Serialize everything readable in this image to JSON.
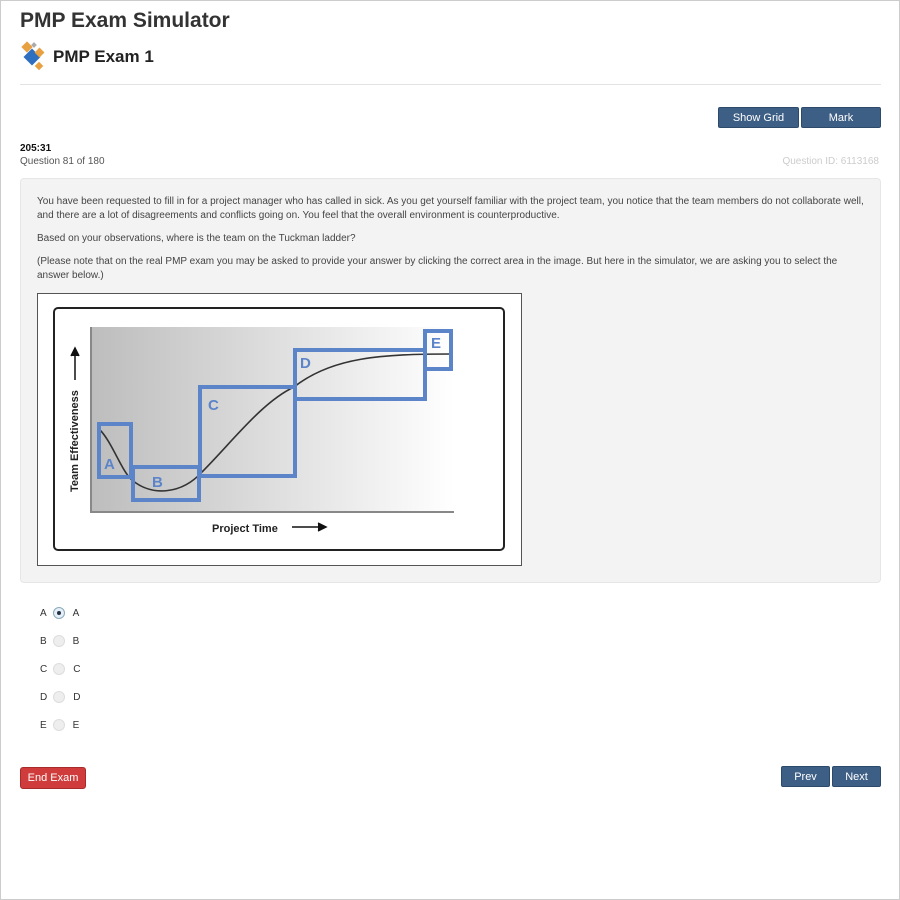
{
  "app_title": "PMP Exam Simulator",
  "exam_title": "PMP Exam 1",
  "toolbar": {
    "show_grid": "Show Grid",
    "mark": "Mark"
  },
  "timer": "205:31",
  "question_number": "Question 81 of 180",
  "question_id": "Question ID: 6113168",
  "question": {
    "p1": "You have been requested to fill in for a project manager who has called in sick. As you get yourself familiar with the project team, you notice that the team members do not collaborate well, and there are a lot of disagreements and conflicts going on. You feel that the overall environment is counterproductive.",
    "p2": "Based on your observations, where is the team on the Tuckman ladder?",
    "p3": "(Please note that on the real PMP exam you may be asked to provide your answer by clicking the correct area in the image. But here in the simulator, we are asking you to select the answer below.)"
  },
  "figure": {
    "ylabel": "Team Effectiveness",
    "xlabel": "Project Time",
    "regions": [
      "A",
      "B",
      "C",
      "D",
      "E"
    ],
    "region_color": "#5b84c9"
  },
  "options": [
    {
      "letter": "A",
      "label": "A",
      "selected": true
    },
    {
      "letter": "B",
      "label": "B",
      "selected": false
    },
    {
      "letter": "C",
      "label": "C",
      "selected": false
    },
    {
      "letter": "D",
      "label": "D",
      "selected": false
    },
    {
      "letter": "E",
      "label": "E",
      "selected": false
    }
  ],
  "footer": {
    "end_exam": "End Exam",
    "prev": "Prev",
    "next": "Next"
  },
  "colors": {
    "primary": "#3e5f85",
    "danger": "#d03b3b"
  }
}
